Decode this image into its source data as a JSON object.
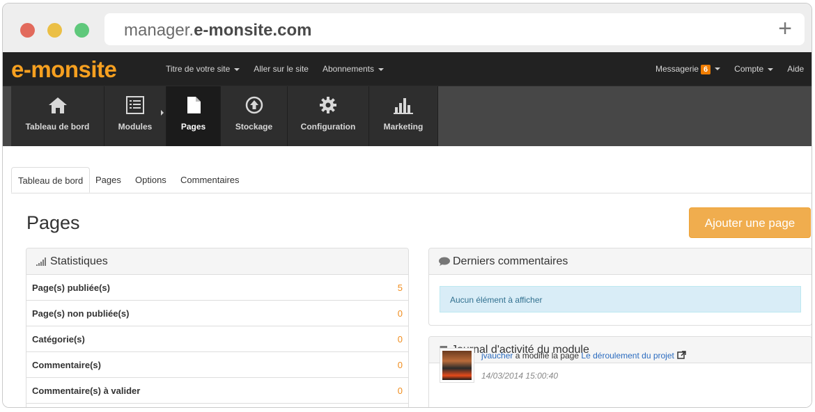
{
  "browser": {
    "url_prefix": "manager.",
    "url_domain": "e-monsite.com",
    "new_tab_symbol": "+"
  },
  "topbar": {
    "logo": "e-monsite",
    "left_items": [
      "Titre de votre site",
      "Aller sur le site",
      "Abonnements"
    ],
    "messagerie_label": "Messagerie",
    "messagerie_count": "6",
    "compte_label": "Compte",
    "aide_label": "Aide"
  },
  "modules": [
    {
      "label": "Tableau de bord",
      "icon": "home-icon"
    },
    {
      "label": "Modules",
      "icon": "list-icon"
    },
    {
      "label": "Pages",
      "icon": "file-icon",
      "active": true
    },
    {
      "label": "Stockage",
      "icon": "upload-icon"
    },
    {
      "label": "Configuration",
      "icon": "gear-icon"
    },
    {
      "label": "Marketing",
      "icon": "bar-chart-icon"
    }
  ],
  "tabs": [
    "Tableau de bord",
    "Pages",
    "Options",
    "Commentaires"
  ],
  "page": {
    "title": "Pages",
    "add_button": "Ajouter une page"
  },
  "stats": {
    "title": "Statistiques",
    "rows": [
      {
        "label": "Page(s) publiée(s)",
        "value": "5"
      },
      {
        "label": "Page(s) non publiée(s)",
        "value": "0"
      },
      {
        "label": "Catégorie(s)",
        "value": "0"
      },
      {
        "label": "Commentaire(s)",
        "value": "0"
      },
      {
        "label": "Commentaire(s) à valider",
        "value": "0"
      }
    ]
  },
  "comments": {
    "title": "Derniers commentaires",
    "empty": "Aucun élément à afficher"
  },
  "journal": {
    "title": "Journal d'activité du module",
    "user": "jvaucher",
    "action": " a modifié la page ",
    "page_link": "Le déroulement du projet",
    "date": "14/03/2014 15:00:40"
  },
  "colors": {
    "accent": "#f6a020",
    "button": "#f0ad4e",
    "link": "#2a6bbf"
  }
}
